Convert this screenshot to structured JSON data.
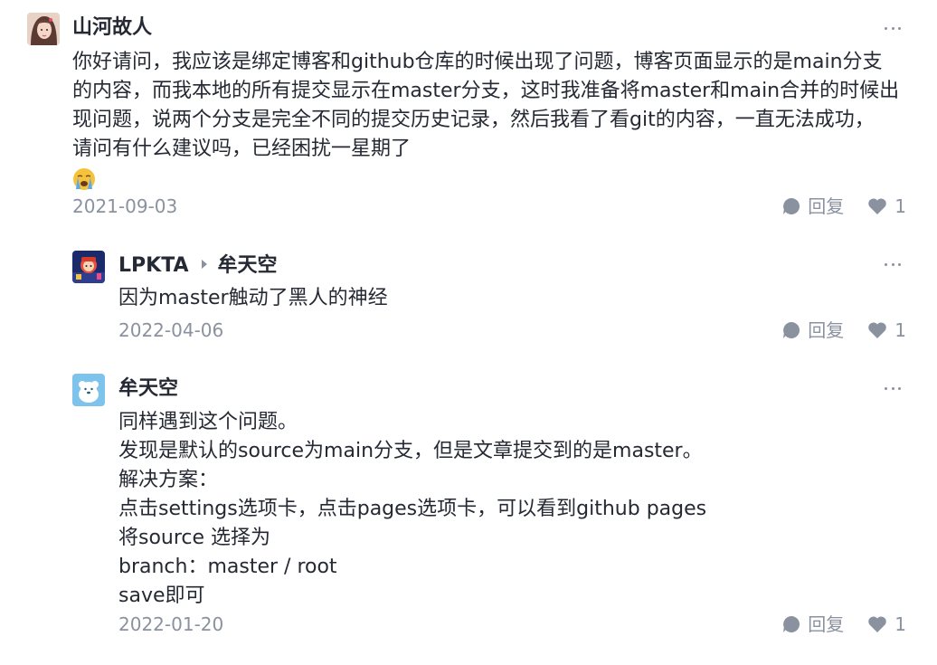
{
  "colors": {
    "text": "#252933",
    "muted": "#8a919f",
    "icon": "#8a919f"
  },
  "comments": [
    {
      "username": "山河故人",
      "avatar_icon": "avatar-girl-icon",
      "lines": [
        "你好请问，我应该是绑定博客和github仓库的时候出现了问题，博客页面显示的是main分支",
        "的内容，而我本地的所有提交显示在master分支，这时我准备将master和main合并的时候出",
        "现问题，说两个分支是完全不同的提交历史记录，然后我看了看git的内容，一直无法成功，",
        "请问有什么建议吗，已经困扰一星期了"
      ],
      "emoji": "loudly-crying-face-icon",
      "date": "2021-09-03",
      "reply_label": "回复",
      "like_count": "1"
    },
    {
      "username": "LPKTA",
      "reply_to": "牟天空",
      "avatar_icon": "avatar-game-icon",
      "lines": [
        "因为master触动了黑人的神经"
      ],
      "date": "2022-04-06",
      "reply_label": "回复",
      "like_count": "1"
    },
    {
      "username": "牟天空",
      "avatar_icon": "avatar-bear-icon",
      "lines": [
        "同样遇到这个问题。",
        "发现是默认的source为main分支，但是文章提交到的是master。",
        "解决方案：",
        "点击settings选项卡，点击pages选项卡，可以看到github pages",
        "将source 选择为",
        "branch：master / root",
        "save即可"
      ],
      "date": "2022-01-20",
      "reply_label": "回复",
      "like_count": "1"
    }
  ]
}
